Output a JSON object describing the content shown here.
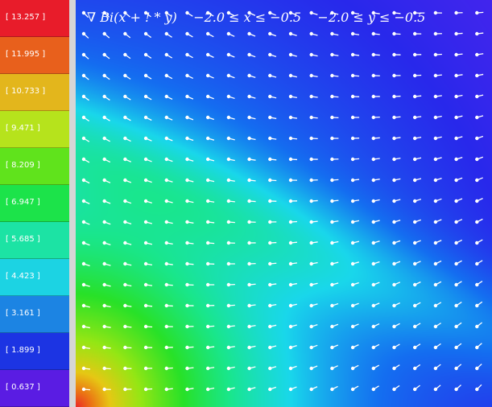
{
  "chart_data": {
    "type": "heatmap",
    "title": "∇ Bi(x + ! * y)    −2.0 ≤ x ≤ −0.5    −2.0 ≤ y ≤ −0.5",
    "x_range": [
      -2.0,
      -0.5
    ],
    "y_range": [
      -2.0,
      -0.5
    ],
    "colorbar": {
      "levels": [
        "[ 13.257 ]",
        "[ 11.995 ]",
        "[ 10.733 ]",
        "[ 9.471 ]",
        "[ 8.209 ]",
        "[ 6.947 ]",
        "[ 5.685 ]",
        "[ 4.423 ]",
        "[ 3.161 ]",
        "[ 1.899 ]",
        "[ 0.637 ]"
      ],
      "colors": [
        "#e81c2a",
        "#e8601c",
        "#e3b61c",
        "#b6e31c",
        "#60e31c",
        "#1ce34a",
        "#1ce3a4",
        "#1cd3e3",
        "#1c84e3",
        "#1c34e3",
        "#5a1ce3"
      ]
    },
    "field_note": "vector arrows over color-mapped magnitude"
  }
}
